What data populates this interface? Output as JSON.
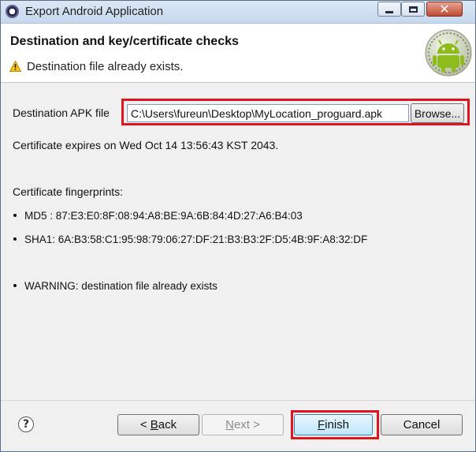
{
  "window": {
    "title": "Export Android Application",
    "close_glyph": "✕"
  },
  "banner": {
    "title": "Destination and key/certificate checks",
    "message": "Destination file already exists.",
    "message_icon": "warning-icon",
    "logo_icon": "android-logo"
  },
  "destination": {
    "label": "Destination APK file",
    "value": "C:\\Users\\fureun\\Desktop\\MyLocation_proguard.apk",
    "browse_label": "Browse..."
  },
  "certificate": {
    "expires": "Certificate expires on Wed Oct 14 13:56:43 KST 2043.",
    "fingerprints_heading": "Certificate fingerprints:",
    "md5": "MD5 : 87:E3:E0:8F:08:94:A8:BE:9A:6B:84:4D:27:A6:B4:03",
    "sha1": "SHA1: 6A:B3:58:C1:95:98:79:06:27:DF:21:B3:B3:2F:D5:4B:9F:A8:32:DF"
  },
  "warning": {
    "text": "WARNING: destination file already exists"
  },
  "footer": {
    "help_glyph": "?",
    "back_prefix": "< ",
    "back_mnemonic": "B",
    "back_rest": "ack",
    "next_mnemonic": "N",
    "next_rest": "ext >",
    "finish_mnemonic": "F",
    "finish_rest": "inish",
    "cancel_label": "Cancel"
  },
  "colors": {
    "highlight": "#e0141e",
    "android_green": "#8ebc1c"
  }
}
